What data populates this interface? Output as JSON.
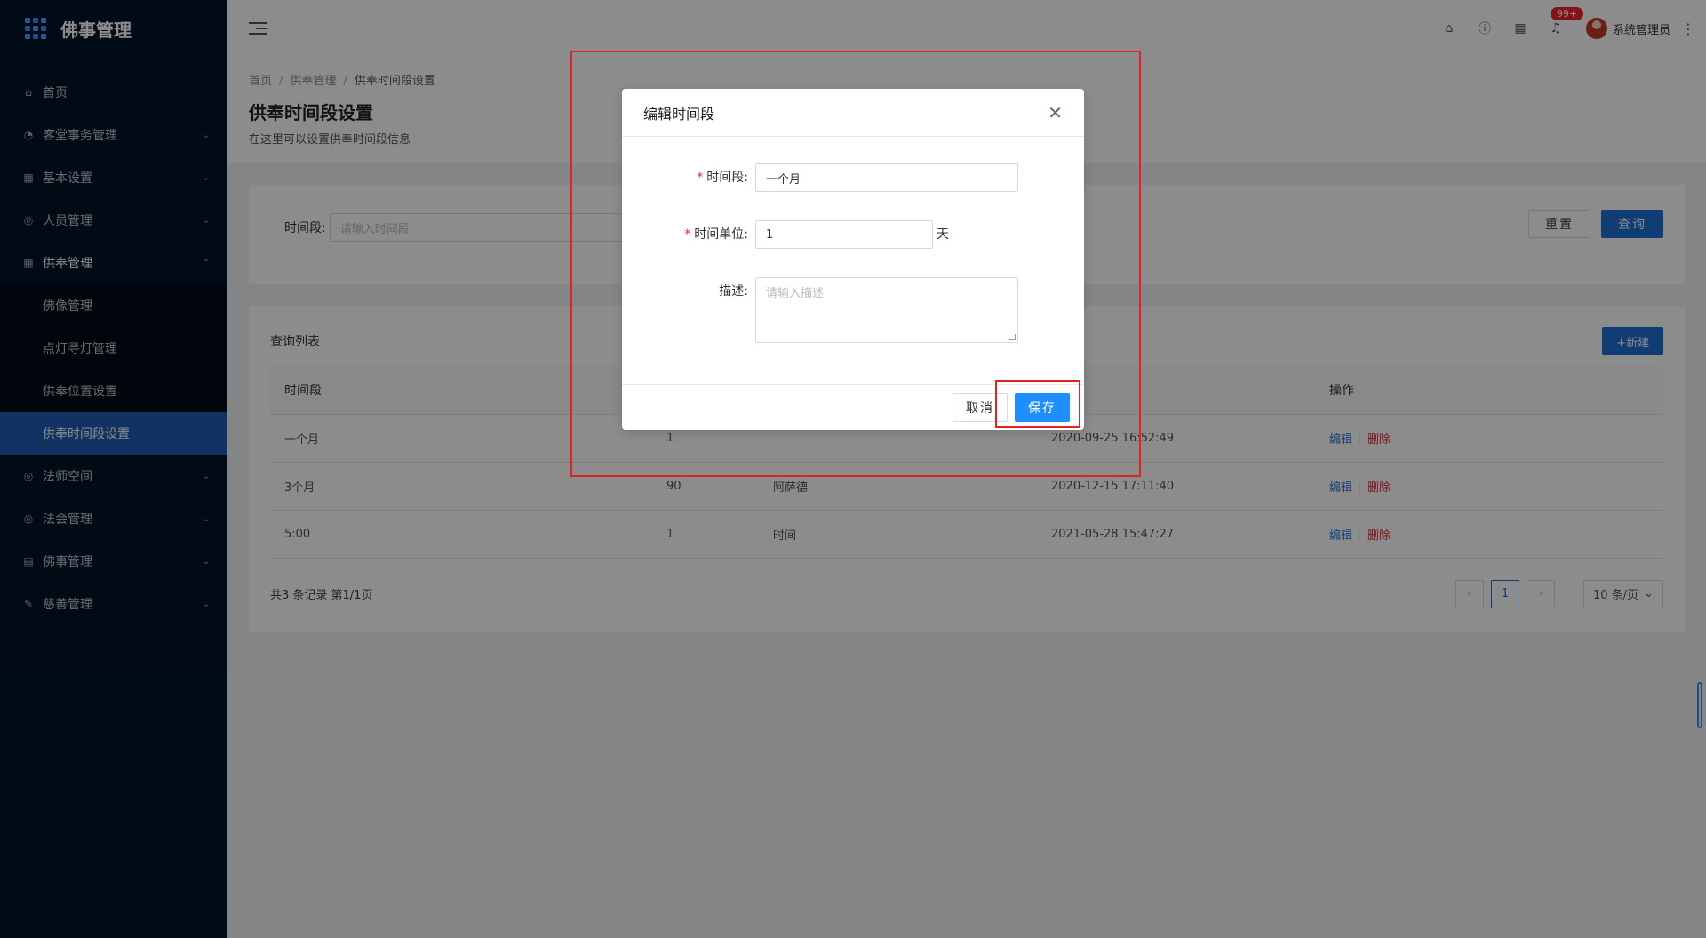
{
  "app": {
    "title": "佛事管理"
  },
  "sidebar": {
    "items": [
      {
        "icon": "home-icon",
        "glyph": "⌂",
        "label": "首页",
        "arrow": ""
      },
      {
        "icon": "dashboard-icon",
        "glyph": "◔",
        "label": "客堂事务管理",
        "arrow": "⌄"
      },
      {
        "icon": "table-icon",
        "glyph": "▦",
        "label": "基本设置",
        "arrow": "⌄"
      },
      {
        "icon": "check-circle-icon",
        "glyph": "◎",
        "label": "人员管理",
        "arrow": "⌄"
      },
      {
        "icon": "table-icon",
        "glyph": "▦",
        "label": "供奉管理",
        "arrow": "⌃"
      }
    ],
    "subitems": [
      {
        "label": "佛像管理"
      },
      {
        "label": "点灯寻灯管理"
      },
      {
        "label": "供奉位置设置"
      },
      {
        "label": "供奉时间段设置"
      }
    ],
    "items_after": [
      {
        "icon": "check-circle-icon",
        "glyph": "◎",
        "label": "法师空间",
        "arrow": "⌄"
      },
      {
        "icon": "check-circle-icon",
        "glyph": "◎",
        "label": "法会管理",
        "arrow": "⌄"
      },
      {
        "icon": "file-icon",
        "glyph": "▤",
        "label": "佛事管理",
        "arrow": "⌄"
      },
      {
        "icon": "edit-icon",
        "glyph": "✎",
        "label": "慈善管理",
        "arrow": "⌄"
      }
    ]
  },
  "header": {
    "badge": "99+",
    "username": "系统管理员"
  },
  "breadcrumb": [
    "首页",
    "供奉管理",
    "供奉时间段设置"
  ],
  "page": {
    "title": "供奉时间段设置",
    "desc": "在这里可以设置供奉时间段信息"
  },
  "search": {
    "label": "时间段:",
    "placeholder": "请输入时间段",
    "reset": "重置",
    "query": "查询"
  },
  "list": {
    "title": "查询列表",
    "new_btn": "+新建",
    "columns": [
      "时间段",
      "",
      "",
      "间",
      "操作"
    ],
    "rows": [
      {
        "period": "一个月",
        "days": "1",
        "desc": "",
        "time": "2020-09-25 16:52:49"
      },
      {
        "period": "3个月",
        "days": "90",
        "desc": "阿萨德",
        "time": "2020-12-15 17:11:40"
      },
      {
        "period": "5:00",
        "days": "1",
        "desc": "时间",
        "time": "2021-05-28 15:47:27"
      }
    ],
    "edit": "编辑",
    "delete": "删除",
    "total": "共3 条记录 第1/1页",
    "current_page": "1",
    "page_size": "10 条/页"
  },
  "modal": {
    "title": "编辑时间段",
    "fields": {
      "period_label": "时间段:",
      "period_value": "一个月",
      "unit_label": "时间单位:",
      "unit_value": "1",
      "unit_suffix": "天",
      "desc_label": "描述:",
      "desc_placeholder": "请输入描述"
    },
    "cancel": "取消",
    "save": "保存"
  }
}
